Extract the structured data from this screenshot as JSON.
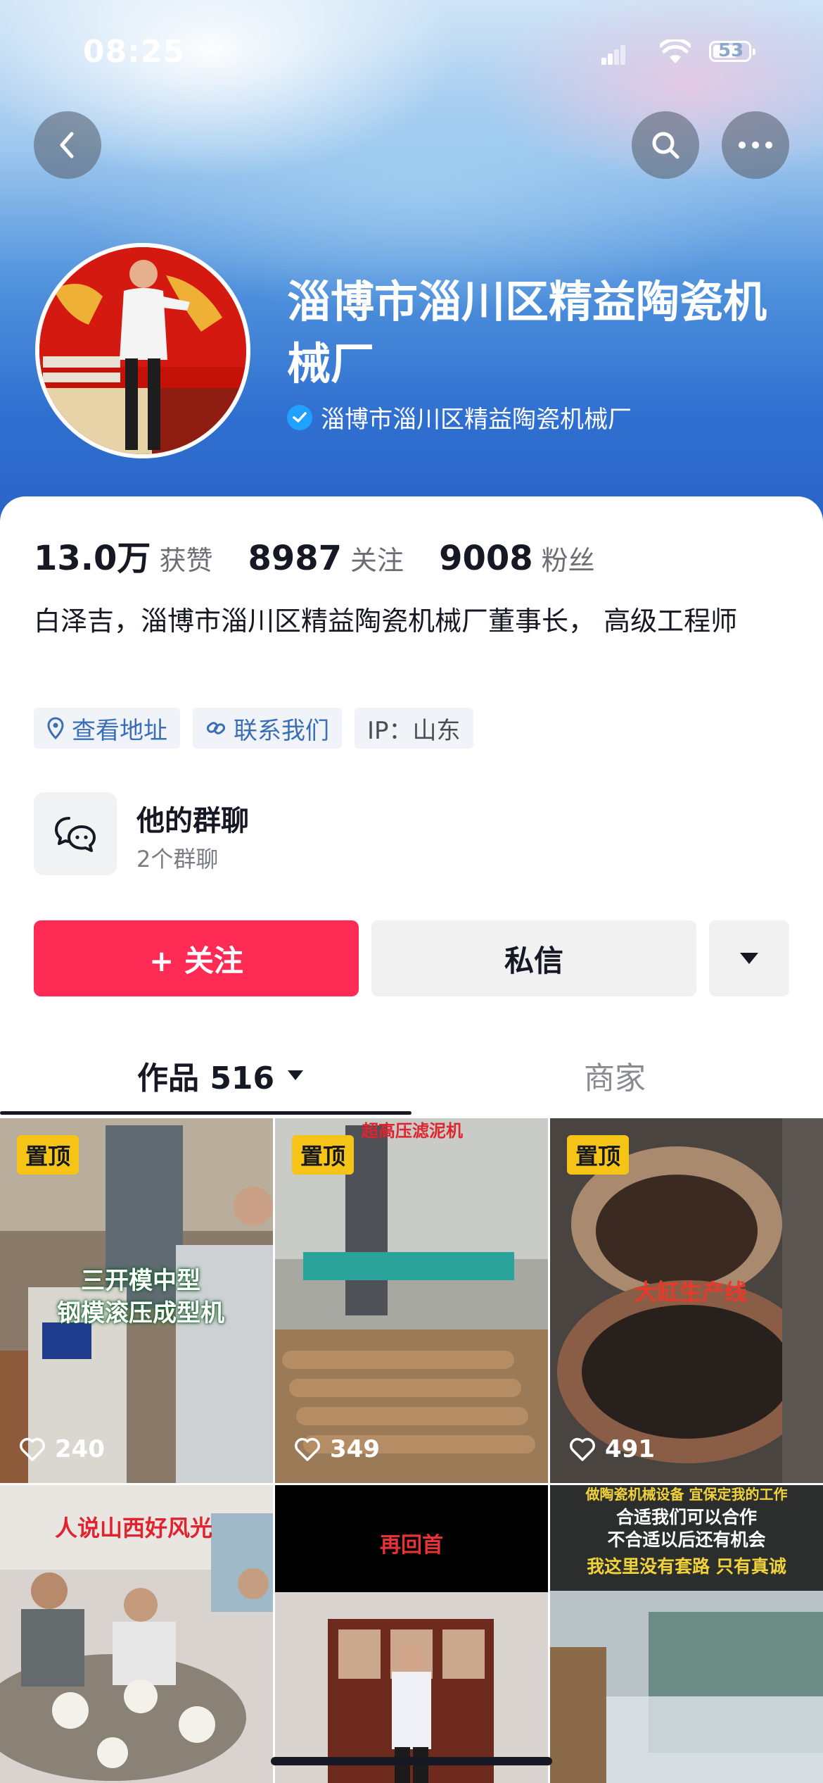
{
  "status_bar": {
    "time": "08:25",
    "battery": "53"
  },
  "profile": {
    "name": "淄博市淄川区精益陶瓷机械厂",
    "verified_label": "淄博市淄川区精益陶瓷机械厂",
    "stats": [
      {
        "value": "13.0万",
        "label": "获赞"
      },
      {
        "value": "8987",
        "label": "关注"
      },
      {
        "value": "9008",
        "label": "粉丝"
      }
    ],
    "bio": "白泽吉，淄博市淄川区精益陶瓷机械厂董事长， 高级工程师",
    "tags": {
      "address": "查看地址",
      "contact": "联系我们",
      "ip": "IP：山东"
    }
  },
  "group_chat": {
    "title": "他的群聊",
    "subtitle": "2个群聊"
  },
  "actions": {
    "follow": "+ 关注",
    "message": "私信"
  },
  "tabs": {
    "works": "作品 516",
    "shop": "商家"
  },
  "videos": [
    {
      "pinned": "置顶",
      "likes": "240",
      "caption_line1": "三开模中型",
      "caption_line2": "钢模滚压成型机"
    },
    {
      "pinned": "置顶",
      "likes": "349",
      "caption_top": "超高压滤泥机"
    },
    {
      "pinned": "置顶",
      "likes": "491",
      "caption": "大缸生产线"
    },
    {
      "caption": "人说山西好风光"
    },
    {
      "caption": "再回首"
    },
    {
      "caption_line1": "做陶瓷机械设备 宜保定我的工作",
      "caption_line2": "合适我们可以合作",
      "caption_line3": "不合适以后还有机会",
      "caption_line4": "我这里没有套路 只有真诚"
    }
  ],
  "colors": {
    "accent": "#fe2c55",
    "pin": "#f6c416",
    "link": "#3a6fb5",
    "verified": "#20a0ff"
  }
}
